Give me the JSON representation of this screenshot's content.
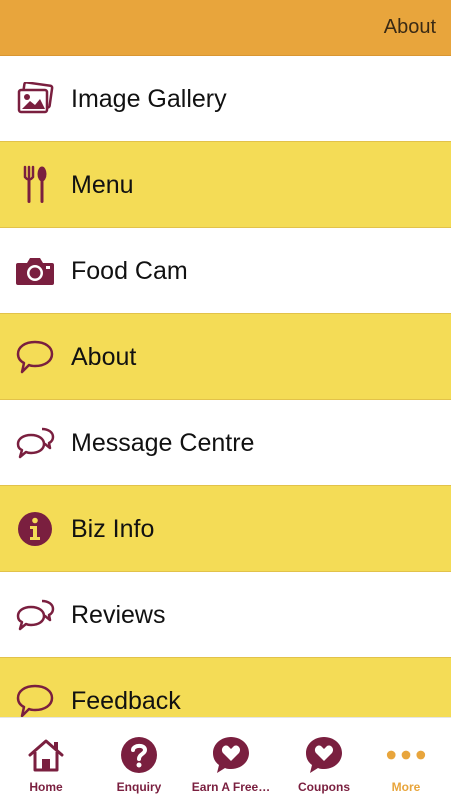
{
  "header": {
    "title": "About"
  },
  "menu": {
    "items": [
      {
        "label": "Image Gallery",
        "icon": "image-gallery-icon"
      },
      {
        "label": "Menu",
        "icon": "fork-spoon-icon"
      },
      {
        "label": "Food Cam",
        "icon": "camera-icon"
      },
      {
        "label": "About",
        "icon": "speech-bubble-icon"
      },
      {
        "label": "Message Centre",
        "icon": "chat-bubbles-icon"
      },
      {
        "label": "Biz Info",
        "icon": "info-icon"
      },
      {
        "label": "Reviews",
        "icon": "chat-bubbles-icon"
      },
      {
        "label": "Feedback",
        "icon": "speech-bubble-icon"
      }
    ]
  },
  "tabbar": {
    "tabs": [
      {
        "label": "Home",
        "icon": "home-icon"
      },
      {
        "label": "Enquiry",
        "icon": "question-icon"
      },
      {
        "label": "Earn A Free…",
        "icon": "heart-bubble-icon"
      },
      {
        "label": "Coupons",
        "icon": "heart-bubble-icon"
      },
      {
        "label": "More",
        "icon": "more-dots-icon"
      }
    ]
  },
  "colors": {
    "header_bg": "#e8a53c",
    "row_yellow": "#f4dc56",
    "icon_maroon": "#7a1f3f",
    "more_accent": "#e8a53c"
  }
}
